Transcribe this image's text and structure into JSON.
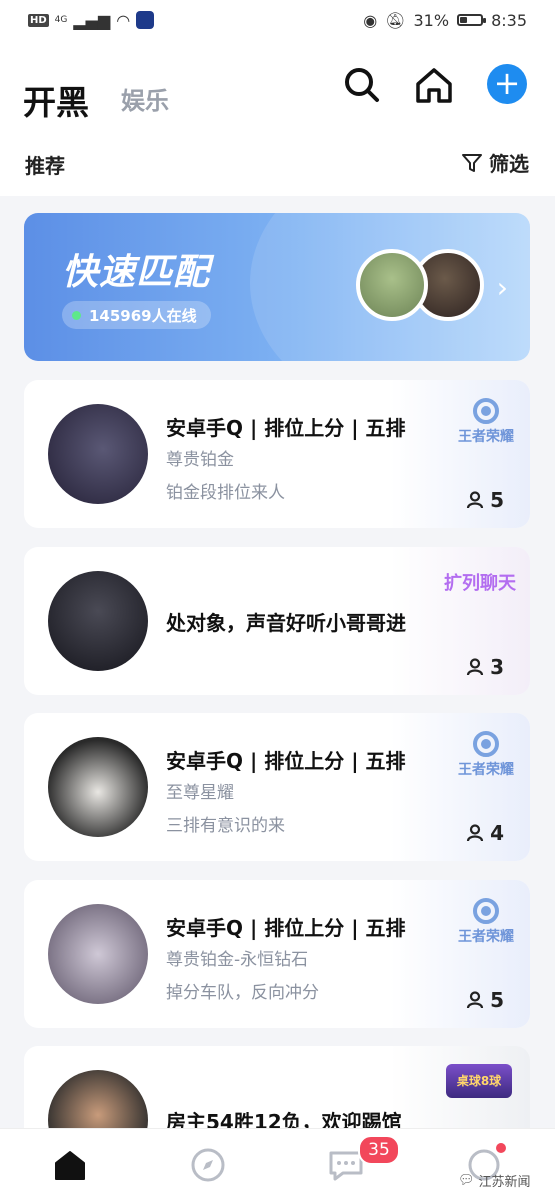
{
  "status_bar": {
    "battery": "31%",
    "time": "8:35",
    "hd": "HD",
    "network": "4G",
    "battery_level": 0.31
  },
  "header": {
    "tab_main": "开黑",
    "tab_sub": "娱乐",
    "section_label": "推荐",
    "filter_label": "筛选"
  },
  "quick_match": {
    "title": "快速匹配",
    "online_text": "145969人在线"
  },
  "rooms": [
    {
      "title": "安卓手Q | 排位上分 | 五排",
      "rank": "尊贵铂金",
      "note": "铂金段排位来人",
      "count": "5",
      "tag": "王者荣耀"
    },
    {
      "title": "处对象，声音好听小哥哥进",
      "rank": "",
      "note": "",
      "count": "3",
      "tag": "扩列聊天"
    },
    {
      "title": "安卓手Q | 排位上分 | 五排",
      "rank": "至尊星耀",
      "note": "三排有意识的来",
      "count": "4",
      "tag": "王者荣耀"
    },
    {
      "title": "安卓手Q | 排位上分 | 五排",
      "rank": "尊贵铂金-永恒钻石",
      "note": "掉分车队，反向冲分",
      "count": "5",
      "tag": "王者荣耀"
    },
    {
      "title": "房主54胜12负，欢迎踢馆",
      "rank": "",
      "note": "",
      "count": "",
      "tag": "桌球8球"
    }
  ],
  "tabbar": {
    "messages_badge": "35",
    "watermark": "江苏新闻"
  },
  "colors": {
    "accent": "#1e8cf0",
    "badge_red": "#f2475b"
  }
}
